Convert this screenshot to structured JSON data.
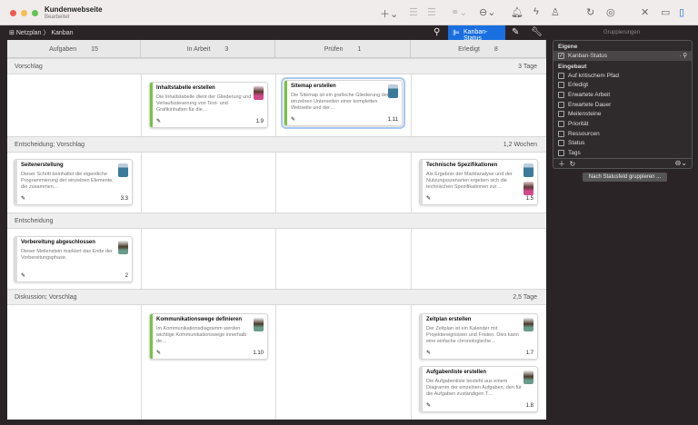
{
  "window": {
    "title": "Kundenwebseite",
    "subtitle": "Bearbeitet"
  },
  "toolbar": {
    "breadcrumb": [
      "Netzplan",
      "Kanban"
    ],
    "kanban_status_label": "Kanban-Status",
    "groupings_label": "Gruppierungen"
  },
  "columns": [
    {
      "label": "Aufgaben",
      "count": "15"
    },
    {
      "label": "In Arbeit",
      "count": "3"
    },
    {
      "label": "Prüfen",
      "count": "1"
    },
    {
      "label": "Erledigt",
      "count": "8"
    }
  ],
  "groups": [
    {
      "label": "Vorschlag",
      "duration": "3 Tage",
      "cards": [
        {
          "col": 1,
          "title": "Inhaltstabelle erstellen",
          "desc": "Die Inhaltstabelle dient der Gliederung und Verlaufssteuerung von Text- und Grafikinhalten für die…",
          "num": "1.9",
          "style": "green",
          "avatars": [
            "f"
          ]
        },
        {
          "col": 2,
          "title": "Sitemap erstellen",
          "desc": "Die Sitemap ist ein grafische Gliederung der einzelnen Unterseiten einer kompletten Webseite und der…",
          "num": "1.11",
          "style": "green sel",
          "avatars": [
            "m"
          ]
        }
      ]
    },
    {
      "label": "Entscheidung; Vorschlag",
      "duration": "1,2 Wochen",
      "cards": [
        {
          "col": 0,
          "title": "Seitenerstellung",
          "desc": "Dieser Schritt beinhaltet die eigentliche Programmierung der einzelnen Elemente, die zusammen…",
          "num": "3.3",
          "style": "",
          "avatars": [
            "m"
          ]
        },
        {
          "col": 3,
          "title": "Technische Spezifikationen",
          "desc": "Als Ergebnis der Marktanalyse und der Nutzungsszenarien ergeben sich die technischen Spezifikationen zur…",
          "num": "1.5",
          "style": "",
          "avatars": [
            "m",
            "f"
          ]
        }
      ]
    },
    {
      "label": "Entscheidung",
      "duration": "",
      "cards": [
        {
          "col": 0,
          "title": "Vorbereitung abgeschlossen",
          "desc": "Dieser Meilenstein markiert das Ende der Vorbereitungsphase.",
          "num": "2",
          "style": "",
          "avatars": [
            "f2"
          ]
        }
      ]
    },
    {
      "label": "Diskussion; Vorschlag",
      "duration": "2,5 Tage",
      "cards": [
        {
          "col": 1,
          "title": "Kommunikationswege definieren",
          "desc": "Im Kommunikationsdiagramm werden wichtige Kommunikationswege innerhalb de…",
          "num": "1.10",
          "style": "green",
          "avatars": [
            "f2"
          ]
        },
        {
          "col": 3,
          "title": "Zeitplan erstellen",
          "desc": "Der Zeitplan ist ein Kalender mit Projektereignissen und Fristen. Dies kann eine einfache chronologische…",
          "num": "1.7",
          "style": "",
          "avatars": [
            "f2"
          ]
        },
        {
          "col": 3,
          "title": "Aufgabenliste erstellen",
          "desc": "Die Aufgabenliste besteht aus einem Diagramm der einzelnen Aufgaben, den für die Aufgaben zuständigen T…",
          "num": "1.8",
          "style": "",
          "avatars": [
            "f2"
          ]
        }
      ]
    }
  ],
  "panel": {
    "own_label": "Eigene",
    "own_items": [
      {
        "label": "Kanban-Status",
        "checked": true
      }
    ],
    "builtin_label": "Eingebaut",
    "builtin_items": [
      "Auf kritischem Pfad",
      "Erledigt",
      "Erwartete Arbeit",
      "Erwartete Dauer",
      "Meilensteine",
      "Priorität",
      "Ressourcen",
      "Status",
      "Tags"
    ],
    "group_button": "Nach Statusfeld gruppieren ..."
  }
}
